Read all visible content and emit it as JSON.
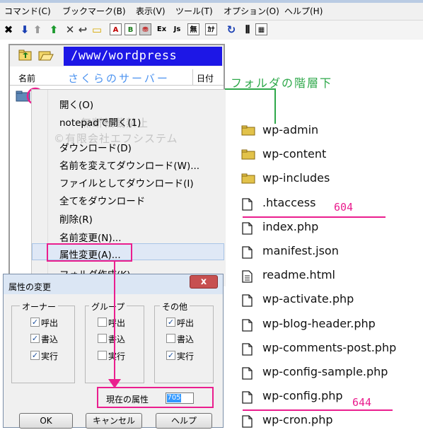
{
  "menubar": {
    "items": [
      "コマンド(C)",
      "ブックマーク(B)",
      "表示(V)",
      "ツール(T)",
      "オプション(O)",
      "ヘルプ(H)"
    ]
  },
  "toolbar": {
    "icons": [
      "disconnect-x-icon",
      "download-arrow-icon",
      "upload-arrow-icon",
      "home-up-icon",
      "cancel-x-icon",
      "back-icon",
      "folder-icon",
      "a-mode-icon",
      "b-mode-icon",
      "auto-mode-icon",
      "ex-icon",
      "js-icon",
      "none-icon",
      "kana-icon",
      "refresh-icon",
      "list-view-icon",
      "detail-view-icon"
    ],
    "labels": {
      "a": "A",
      "b": "B",
      "ex": "Ex",
      "js": "Js",
      "none": "無",
      "kana": "ｶﾅ"
    }
  },
  "panel": {
    "path": "/www/wordpress",
    "columns": {
      "name": "名前",
      "date": "日付"
    },
    "server_label": "さくらのサーバー"
  },
  "context_menu": {
    "items": [
      "開く(O)",
      "notepadで開く(1)",
      "ダウンロード(D)",
      "名前を変えてダウンロード(W)...",
      "ファイルとしてダウンロード(I)",
      "全てをダウンロード",
      "削除(R)",
      "名前変更(N)...",
      "属性変更(A)...",
      "フォルダ作成(K)..."
    ],
    "highlighted_index": 8
  },
  "watermark": {
    "line1": "無断転載禁止",
    "line2": "©有限会社エフシステム"
  },
  "dialog": {
    "title": "属性の変更",
    "close_label": "x",
    "groups": [
      {
        "title": "オーナー",
        "checks": [
          {
            "label": "呼出",
            "checked": true
          },
          {
            "label": "書込",
            "checked": true
          },
          {
            "label": "実行",
            "checked": true
          }
        ]
      },
      {
        "title": "グループ",
        "checks": [
          {
            "label": "呼出",
            "checked": false
          },
          {
            "label": "書込",
            "checked": false
          },
          {
            "label": "実行",
            "checked": false
          }
        ]
      },
      {
        "title": "その他",
        "checks": [
          {
            "label": "呼出",
            "checked": true
          },
          {
            "label": "書込",
            "checked": false
          },
          {
            "label": "実行",
            "checked": true
          }
        ]
      }
    ],
    "current_attr_label": "現在の属性",
    "current_attr_value": "705",
    "buttons": {
      "ok": "OK",
      "cancel": "キャンセル",
      "help": "ヘルプ"
    }
  },
  "annotation": {
    "folder_note": "フォルダの階層下",
    "htaccess_perm": "604",
    "config_perm": "644",
    "accent_color": "#ea1e8e",
    "green_color": "#2ea84a"
  },
  "files": [
    {
      "name": "wp-admin",
      "type": "folder"
    },
    {
      "name": "wp-content",
      "type": "folder"
    },
    {
      "name": "wp-includes",
      "type": "folder"
    },
    {
      "name": ".htaccess",
      "type": "file"
    },
    {
      "name": "index.php",
      "type": "file"
    },
    {
      "name": "manifest.json",
      "type": "file"
    },
    {
      "name": "readme.html",
      "type": "doc"
    },
    {
      "name": "wp-activate.php",
      "type": "file"
    },
    {
      "name": "wp-blog-header.php",
      "type": "file"
    },
    {
      "name": "wp-comments-post.php",
      "type": "file"
    },
    {
      "name": "wp-config-sample.php",
      "type": "file"
    },
    {
      "name": "wp-config.php",
      "type": "file"
    },
    {
      "name": "wp-cron.php",
      "type": "file"
    }
  ]
}
